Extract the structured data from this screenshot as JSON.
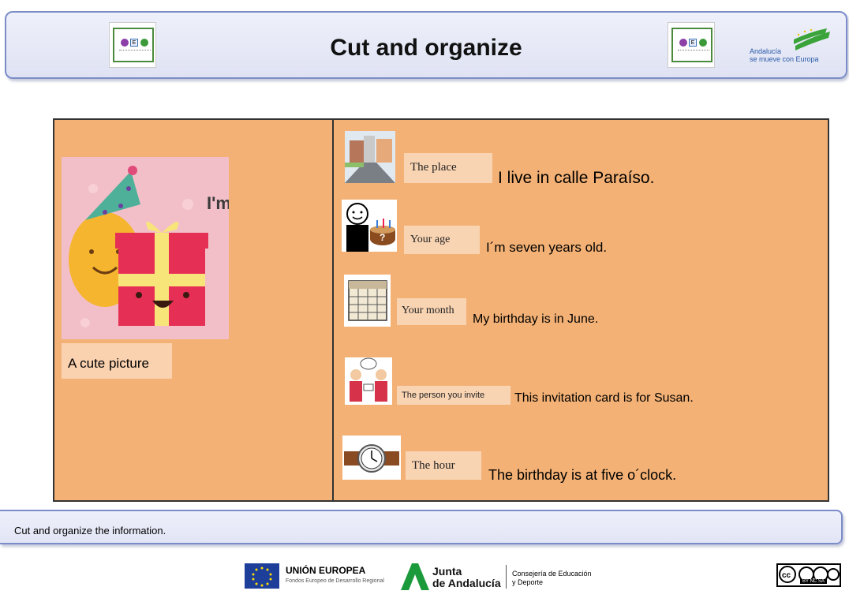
{
  "header": {
    "title": "Cut and organize",
    "logo_text": "Andalucía",
    "logo_subtext": "se mueve con Europa"
  },
  "left_panel": {
    "picture_text": "I'm",
    "label": "A cute picture"
  },
  "rows": [
    {
      "tag": "The place",
      "sentence": "I live in calle Paraíso.",
      "icon": "street-icon"
    },
    {
      "tag": "Your age",
      "sentence": "I´m seven years old.",
      "icon": "birthday-cake-icon"
    },
    {
      "tag": "Your month",
      "sentence": "My birthday is in June.",
      "icon": "calendar-icon"
    },
    {
      "tag": "The person you invite",
      "sentence": "This invitation card is for Susan.",
      "icon": "invitation-icon"
    },
    {
      "tag": "The hour",
      "sentence": "The birthday is at five o´clock.",
      "icon": "watch-icon"
    }
  ],
  "instruction": "Cut and organize the information.",
  "footer": {
    "eu_title": "UNIÓN EUROPEA",
    "eu_subtitle": "Fondos Europeo de Desarrollo Regional",
    "junta_line1": "Junta",
    "junta_line2": "de Andalucía",
    "consejeria_line1": "Consejería de Educación",
    "consejeria_line2": "y Deporte",
    "license": "BY NC SA"
  },
  "colors": {
    "panel": "#f3b175",
    "tag": "#f9d4b3",
    "header_border": "#7b8dc8"
  }
}
